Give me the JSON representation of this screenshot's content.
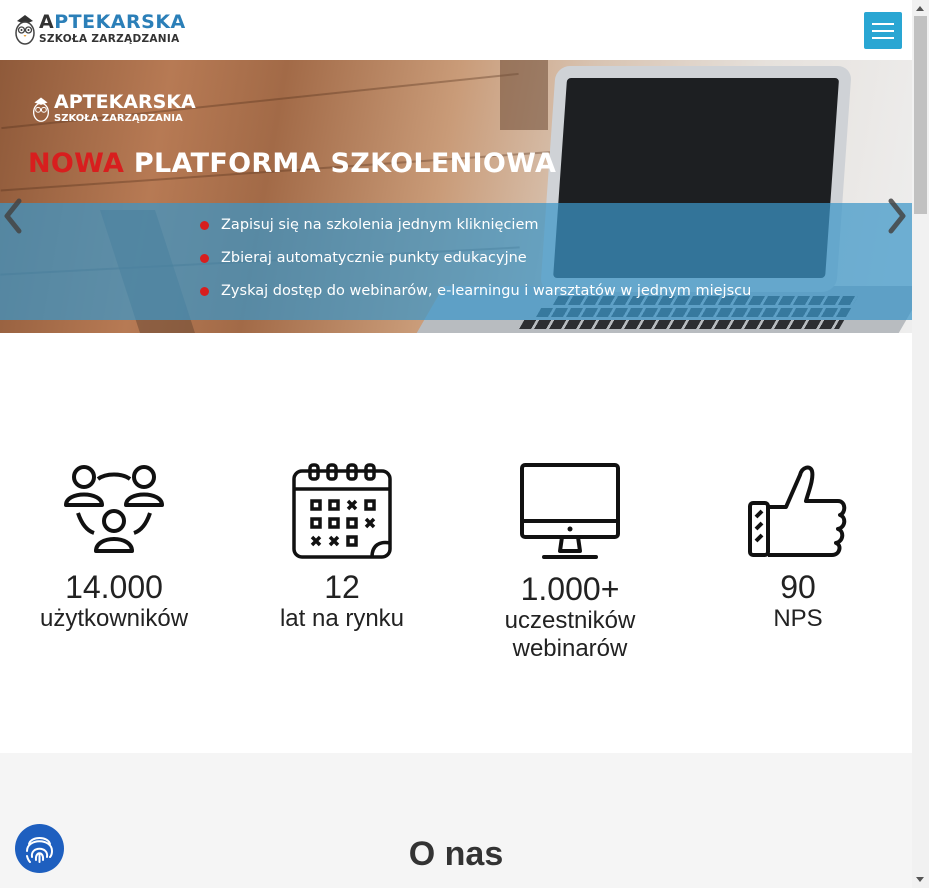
{
  "header": {
    "logo_line1_first": "A",
    "logo_line1_rest": "PTEKARSKA",
    "logo_line2": "SZKOŁA ZARZĄDZANIA",
    "menu_icon": "hamburger-icon"
  },
  "hero": {
    "logo_line1": "APTEKARSKA",
    "logo_line2": "SZKOŁA ZARZĄDZANIA",
    "title_red": "NOWA",
    "title_rest": " PLATFORMA SZKOLENIOWA",
    "bullets": [
      "Zapisuj się na szkolenia jednym kliknięciem",
      "Zbieraj automatycznie punkty edukacyjne",
      "Zyskaj dostęp do webinarów, e-learningu i warsztatów w jednym miejscu"
    ],
    "colors": {
      "accent_red": "#d81e1e",
      "band_blue": "#3c96c8"
    }
  },
  "stats": [
    {
      "icon": "users-group-icon",
      "number": "14.000",
      "label": "użytkowników"
    },
    {
      "icon": "calendar-icon",
      "number": "12",
      "label": "lat na rynku"
    },
    {
      "icon": "monitor-icon",
      "number": "1.000+",
      "label": "uczestników webinarów"
    },
    {
      "icon": "thumbs-up-icon",
      "number": "90",
      "label": "NPS"
    }
  ],
  "about": {
    "title": "O nas"
  },
  "widgets": {
    "cookie_button_icon": "fingerprint-icon"
  },
  "colors": {
    "menu_button": "#29a6d3",
    "brand_blue": "#2b7fb8",
    "cookie_button": "#1e5fbf"
  }
}
